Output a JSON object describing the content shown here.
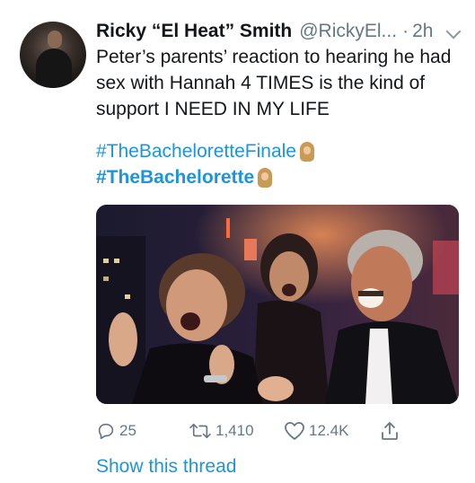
{
  "tweet": {
    "author_name": "Ricky “El Heat” Smith",
    "author_handle": "@RickyEl...",
    "separator": "·",
    "time": "2h",
    "text": "Peter’s parents’ reaction to hearing he had sex with Hannah 4 TIMES is the kind of support I NEED IN MY LIFE",
    "hashtags": [
      {
        "text": "#TheBacheloretteFinale",
        "emoji": "hannah-doll-emoji"
      },
      {
        "text": "#TheBachelorette",
        "emoji": "hannah-doll-emoji"
      }
    ],
    "media_description_icon": "photo-of-excited-audience"
  },
  "actions": {
    "reply": {
      "icon": "reply-icon",
      "count": "25"
    },
    "retweet": {
      "icon": "retweet-icon",
      "count": "1,410"
    },
    "like": {
      "icon": "heart-icon",
      "count": "12.4K"
    },
    "share": {
      "icon": "share-icon"
    }
  },
  "show_thread_label": "Show this thread",
  "colors": {
    "link": "#1b95e0",
    "text": "#14171a",
    "muted": "#657786"
  }
}
